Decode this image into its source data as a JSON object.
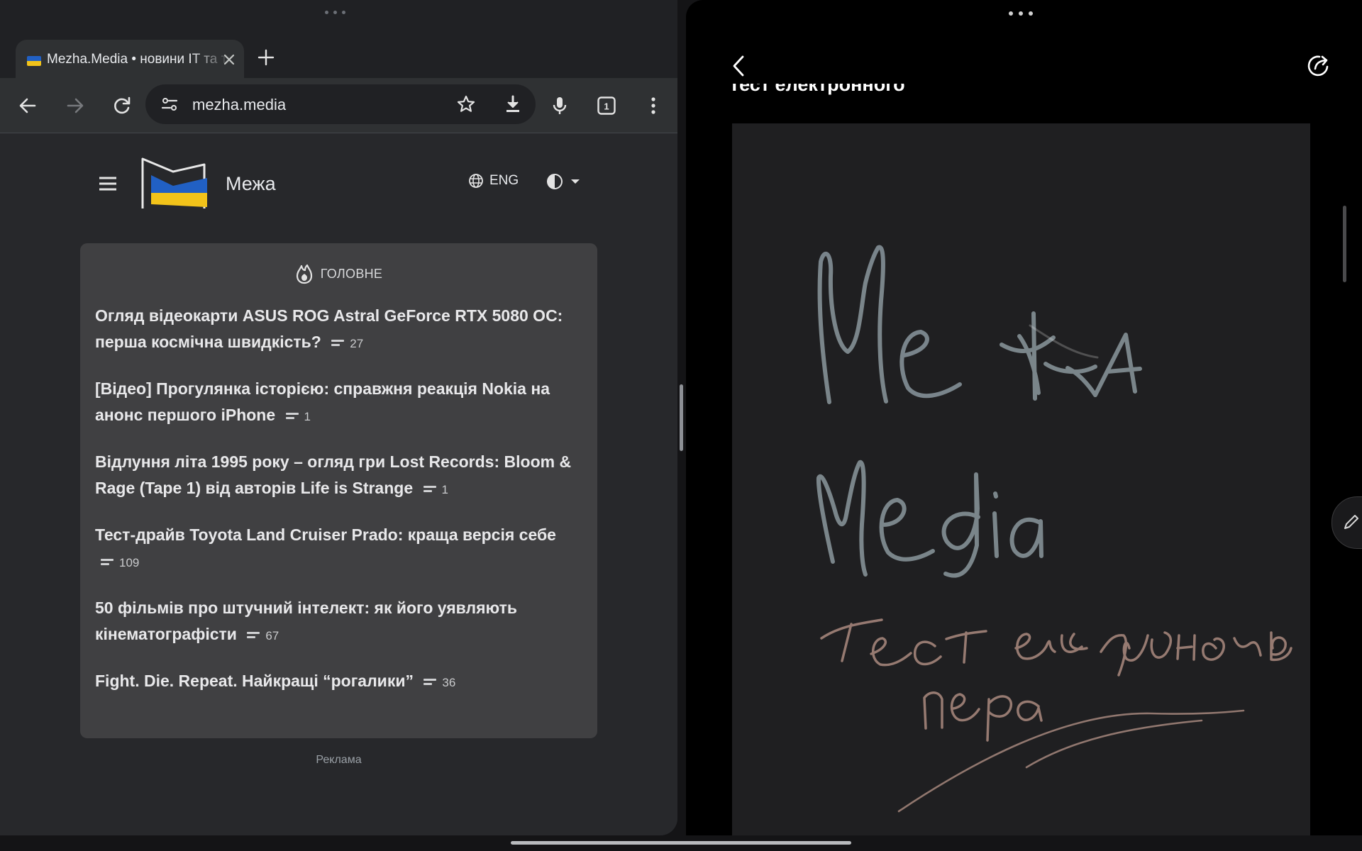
{
  "browser": {
    "tab": {
      "title": "Mezha.Media • новини IT та технологій",
      "favicon": "ukraine-flag-icon"
    },
    "address_bar": {
      "url": "mezha.media"
    },
    "tabs_count": "1",
    "icons": [
      "back-arrow-icon",
      "forward-arrow-icon",
      "reload-icon",
      "site-info-icon",
      "star-icon",
      "download-icon",
      "mic-icon",
      "tab-switcher-icon",
      "more-vert-icon"
    ]
  },
  "site": {
    "name": "Межа",
    "language_label": "ENG",
    "main_section": {
      "heading": "ГОЛОВНЕ",
      "articles": [
        {
          "title": "Огляд відеокарти ASUS ROG Astral GeForce RTX 5080 OC: перша космічна швидкість?",
          "comments": "27"
        },
        {
          "title": "[Відео] Прогулянка історією: справжня реакція Nokia на анонс першого iPhone",
          "comments": "1"
        },
        {
          "title": "Відлуння літа 1995 року – огляд гри Lost Records: Bloom & Rage (Tape 1) від авторів Life is Strange",
          "comments": "1"
        },
        {
          "title": "Тест-драйв Toyota Land Cruiser Prado: краща версія себе",
          "comments": "109"
        },
        {
          "title": "50 фільмів про штучний інтелект: як його уявляють кінематографісти",
          "comments": "67"
        },
        {
          "title": "Fight. Die. Repeat. Найкращі “рогалики”",
          "comments": "36"
        }
      ]
    },
    "ad_label": "Реклама"
  },
  "notes_app": {
    "note_title": "Тест електронного",
    "handwriting": [
      "Межа",
      "Media",
      "Тест електронного",
      "пера"
    ],
    "colors": {
      "ink_gray": "#8a979d",
      "ink_brown": "#b89488"
    }
  },
  "colors": {
    "browser_frame": "#202124",
    "toolbar": "#2f3133",
    "page_bg": "#27282b",
    "card_bg": "#404042",
    "logo_blue": "#2160c4",
    "logo_yellow": "#f2c31a"
  }
}
